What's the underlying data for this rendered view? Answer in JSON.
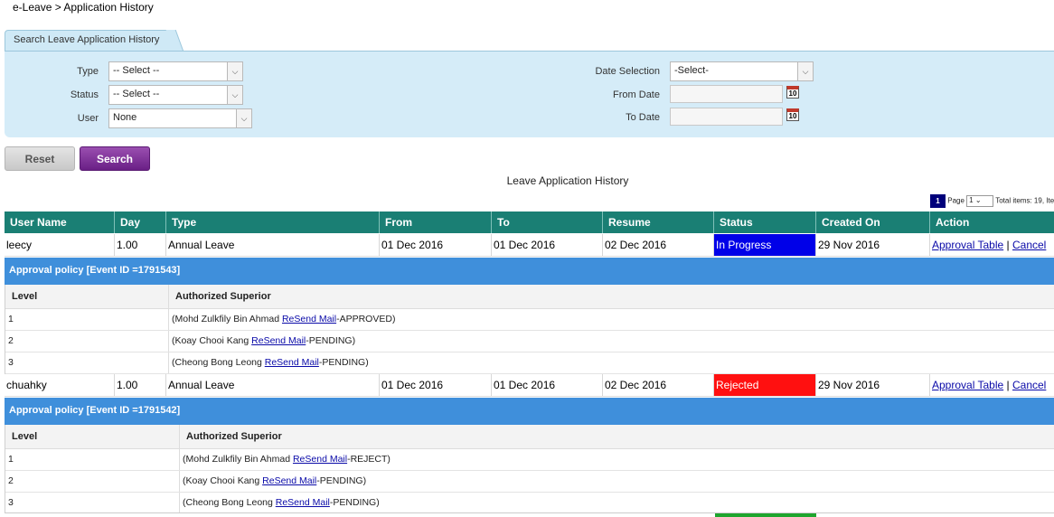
{
  "breadcrumb": "e-Leave > Application History",
  "search": {
    "tab_label": "Search Leave Application History",
    "type_label": "Type",
    "type_value": "-- Select --",
    "status_label": "Status",
    "status_value": "-- Select --",
    "user_label": "User",
    "user_value": "None",
    "date_selection_label": "Date Selection",
    "date_selection_value": "-Select-",
    "from_date_label": "From Date",
    "to_date_label": "To Date",
    "calendar_day": "10"
  },
  "buttons": {
    "reset": "Reset",
    "search": "Search"
  },
  "table_title": "Leave Application History",
  "pager": {
    "current": "1",
    "page_label": "Page",
    "page_value": "1",
    "total": "Total items: 19, Ite"
  },
  "columns": [
    "User Name",
    "Day",
    "Type",
    "From",
    "To",
    "Resume",
    "Status",
    "Created On",
    "Action"
  ],
  "records": [
    {
      "user": "leecy",
      "day": "1.00",
      "type": "Annual Leave",
      "from": "01 Dec 2016",
      "to": "01 Dec 2016",
      "resume": "02 Dec 2016",
      "status": "In Progress",
      "created": "29 Nov 2016",
      "action_approval": "Approval Table",
      "action_sep": "|",
      "action_cancel": "Cancel",
      "policy": "Approval policy [Event ID =1791543]",
      "level_header": "Level",
      "superior_header": "Authorized Superior",
      "approvals": [
        {
          "level": "1",
          "name": "(Mohd Zulkfily Bin Ahmad ",
          "link": "ReSend Mail",
          "result": "-APPROVED)"
        },
        {
          "level": "2",
          "name": "(Koay Chooi Kang ",
          "link": "ReSend Mail",
          "result": "-PENDING)"
        },
        {
          "level": "3",
          "name": "(Cheong Bong Leong ",
          "link": "ReSend Mail",
          "result": "-PENDING)"
        }
      ]
    },
    {
      "user": "chuahky",
      "day": "1.00",
      "type": "Annual Leave",
      "from": "01 Dec 2016",
      "to": "01 Dec 2016",
      "resume": "02 Dec 2016",
      "status": "Rejected",
      "created": "29 Nov 2016",
      "action_approval": "Approval Table",
      "action_sep": "|",
      "action_cancel": "Cancel",
      "policy": "Approval policy [Event ID =1791542]",
      "level_header": "Level",
      "superior_header": "Authorized Superior",
      "approvals": [
        {
          "level": "1",
          "name": "(Mohd Zulkfily Bin Ahmad ",
          "link": "ReSend Mail",
          "result": "-REJECT)"
        },
        {
          "level": "2",
          "name": "(Koay Chooi Kang ",
          "link": "ReSend Mail",
          "result": "-PENDING)"
        },
        {
          "level": "3",
          "name": "(Cheong Bong Leong ",
          "link": "ReSend Mail",
          "result": "-PENDING)"
        }
      ]
    }
  ],
  "colors": {
    "header": "#1a7f74",
    "policy": "#3f8fdb",
    "in_progress": "#0000e8",
    "rejected": "#ff1010"
  }
}
